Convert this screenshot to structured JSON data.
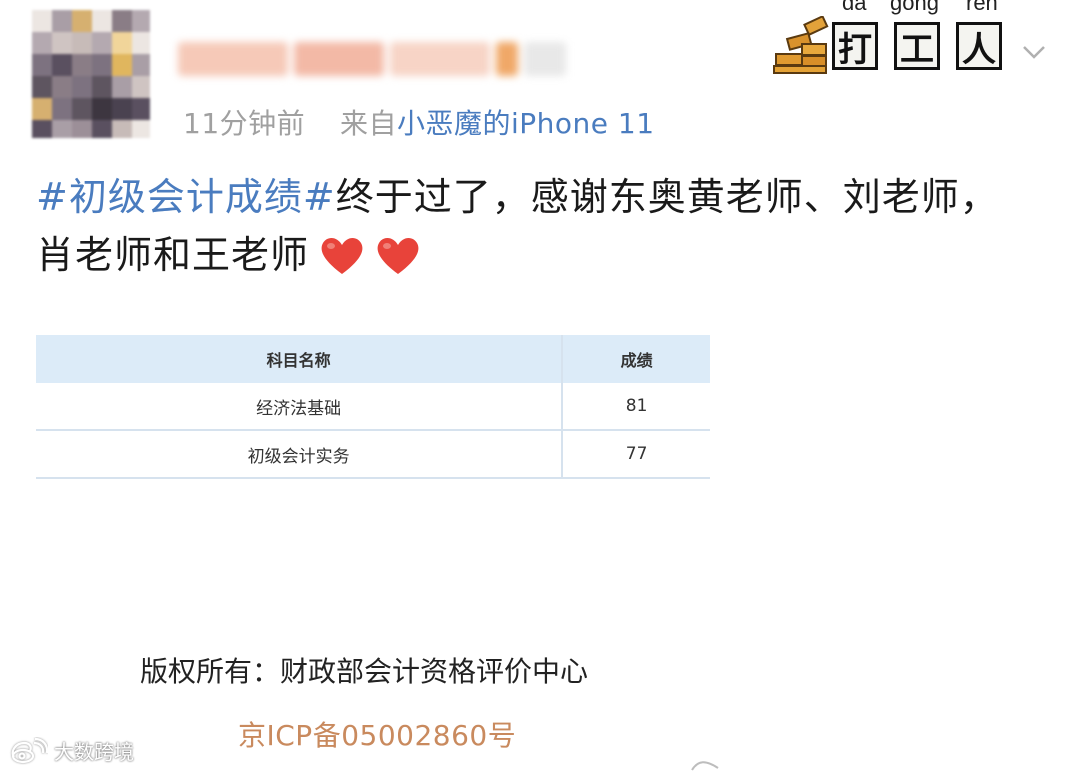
{
  "header": {
    "time": "11分钟前",
    "source_prefix": "来自",
    "device": "小恶魔的iPhone 11"
  },
  "sticker": {
    "pinyin": [
      "da",
      "gong",
      "ren"
    ],
    "chars": [
      "打",
      "工",
      "人"
    ]
  },
  "post": {
    "hashtag": "#初级会计成绩#",
    "text": "终于过了，感谢东奥黄老师、刘老师，肖老师和王老师"
  },
  "score_table": {
    "headers": [
      "科目名称",
      "成绩"
    ],
    "rows": [
      {
        "subject": "经济法基础",
        "score": "81"
      },
      {
        "subject": "初级会计实务",
        "score": "77"
      }
    ]
  },
  "footer": {
    "copyright": "版权所有：财政部会计资格评价中心",
    "icp": "京ICP备05002860号"
  },
  "watermark": {
    "text": "大数跨境"
  },
  "colors": {
    "link": "#4a7cbf",
    "heart": "#e8433a",
    "table_header_bg": "#dcebf8",
    "icp": "#c98a5e"
  },
  "icons": {
    "chevron": "chevron-down-icon",
    "heart": "heart-icon",
    "watermark": "weibo-logo-icon"
  }
}
